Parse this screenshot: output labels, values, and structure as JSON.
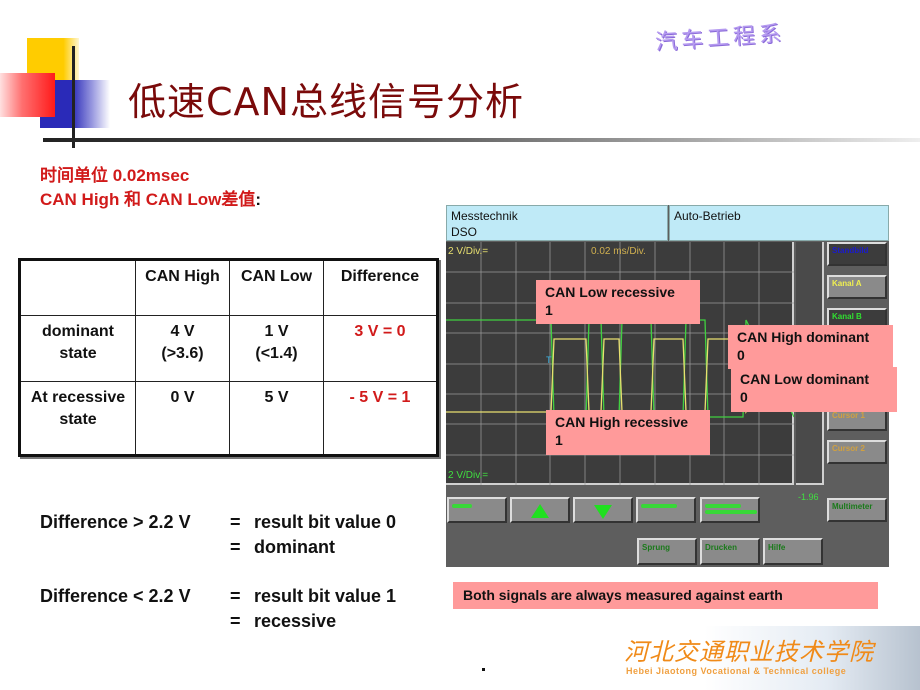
{
  "header": {
    "title": "低速CAN总线信号分析",
    "department": "汽车工程系"
  },
  "subtitle": {
    "line1": "时间单位 0.02msec",
    "line2": "CAN High 和 CAN Low差值",
    "line2_suffix": ":"
  },
  "table": {
    "headers": [
      "",
      "CAN High",
      "CAN Low",
      "Difference"
    ],
    "rows": [
      {
        "state": "dominant state",
        "can_high": "4 V",
        "can_high_note": "(>3.6)",
        "can_low": "1 V",
        "can_low_note": "(<1.4)",
        "difference": "3 V = 0"
      },
      {
        "state": "At recessive state",
        "can_high": "0 V",
        "can_high_note": "",
        "can_low": "5 V",
        "can_low_note": "",
        "difference": "- 5 V = 1"
      }
    ]
  },
  "rules": [
    {
      "left": "Difference > 2.2 V",
      "eq": "=",
      "right": "result bit value 0"
    },
    {
      "left": "",
      "eq": "=",
      "right": "dominant"
    },
    {
      "left": "Difference < 2.2 V",
      "eq": "=",
      "right": "result bit value 1"
    },
    {
      "left": "",
      "eq": "=",
      "right": "recessive"
    }
  ],
  "scope": {
    "header_left_line1": "Messtechnik",
    "header_left_line2": "DSO",
    "header_right": "Auto-Betrieb",
    "channel_a_scale": "2 V/Div.=",
    "timebase": "0.02 ms/Div.",
    "channel_b_scale": "2 V/Div.=",
    "trigger_marker": "T",
    "readout": "-1.96",
    "colors": {
      "channel_a": "#e8e070",
      "channel_b": "#40d040",
      "grid": "#9a9a9a"
    },
    "side_buttons": [
      {
        "label": "Standbild",
        "color": "#1a1ad0"
      },
      {
        "label": "Kanal A",
        "color": "#f0f050"
      },
      {
        "label": "Kanal B",
        "color": "#30e030"
      },
      {
        "label": "",
        "color": "#d0a040"
      },
      {
        "label": "Cursor 1",
        "color": "#d0a040"
      },
      {
        "label": "Cursor 2",
        "color": "#d0a040"
      },
      {
        "label": "Multimeter",
        "color": "#1a7a1a"
      }
    ],
    "bottom_buttons_row1": [
      {
        "label": "",
        "icon": "none"
      },
      {
        "label": "",
        "icon": "arrow-up"
      },
      {
        "label": "",
        "icon": "arrow-down"
      },
      {
        "label": "",
        "icon": "none"
      },
      {
        "label": "",
        "icon": "none"
      }
    ],
    "bottom_buttons_row2": [
      {
        "label": "Sprung"
      },
      {
        "label": "Drucken"
      },
      {
        "label": "Hilfe"
      }
    ]
  },
  "callouts": {
    "can_low_recessive": {
      "title": "CAN Low recessive",
      "value": "1"
    },
    "can_high_dominant": {
      "title": "CAN High dominant",
      "value": "0"
    },
    "can_low_dominant": {
      "title": "CAN Low dominant",
      "value": "0"
    },
    "can_high_recessive": {
      "title": "CAN High recessive",
      "value": "1"
    }
  },
  "note": "Both signals are always measured against earth",
  "logo": {
    "name_cn": "河北交通职业技术学院",
    "name_en": "Hebei Jiaotong Vocational & Technical college"
  },
  "footer_dot": "."
}
